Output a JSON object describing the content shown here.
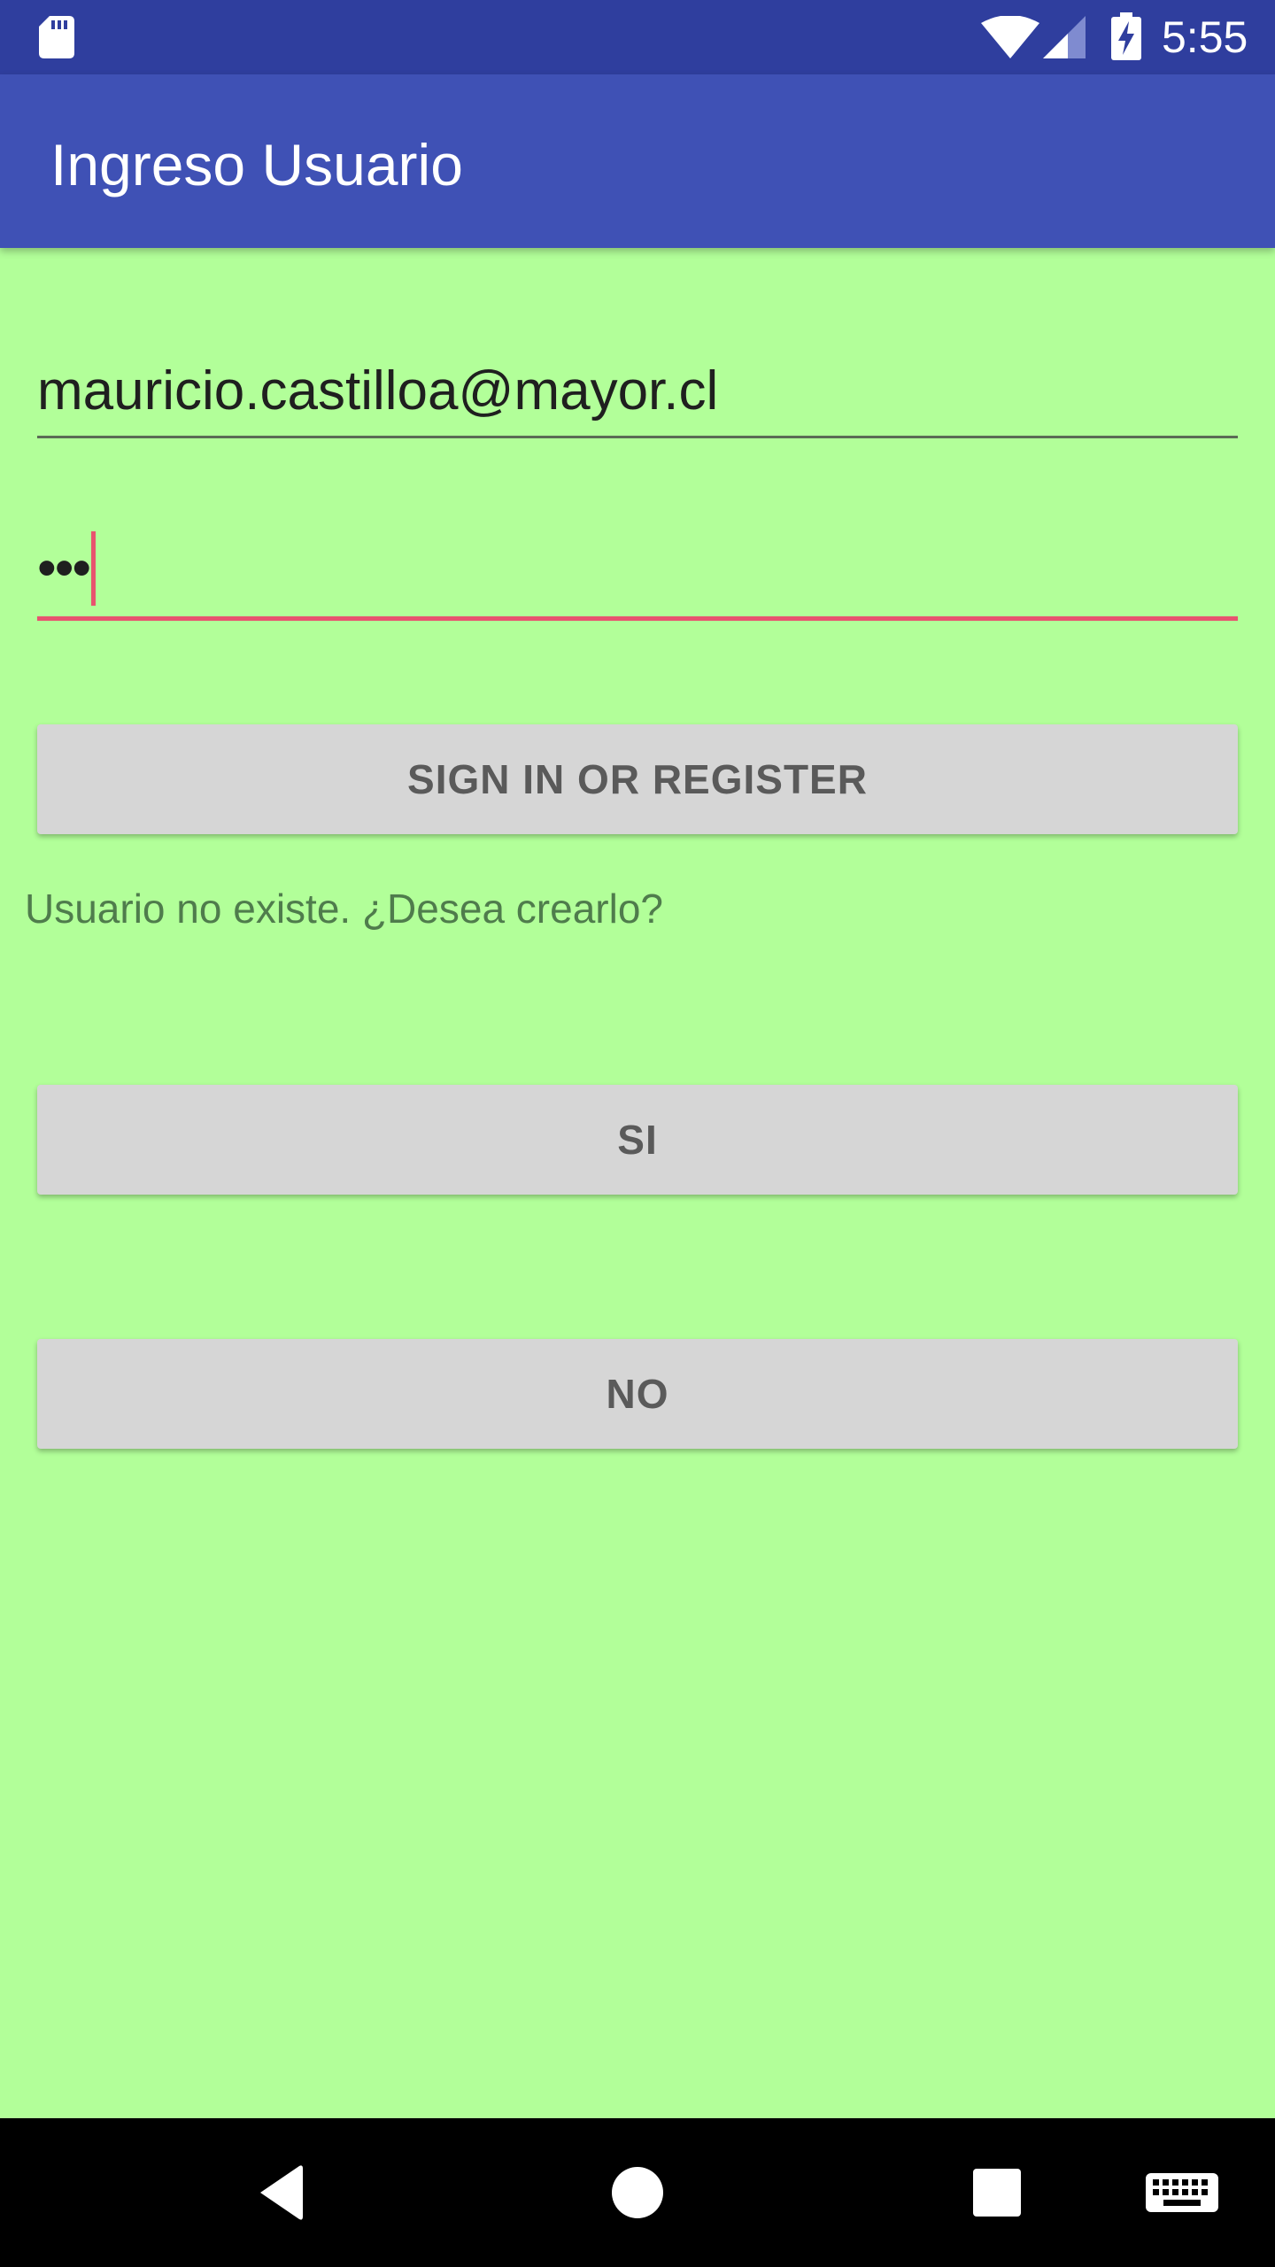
{
  "status_bar": {
    "time": "5:55",
    "icons": [
      "sd-card-icon",
      "wifi-icon",
      "signal-icon",
      "battery-charging-icon"
    ]
  },
  "app_bar": {
    "title": "Ingreso Usuario"
  },
  "form": {
    "email_value": "mauricio.castilloa@mayor.cl",
    "password_masked": "•••",
    "sign_in_label": "SIGN IN OR REGISTER",
    "message": "Usuario no existe. ¿Desea crearlo?",
    "yes_label": "SI",
    "no_label": "NO"
  },
  "nav_bar": {
    "icons": [
      "back-icon",
      "home-icon",
      "recents-icon",
      "keyboard-icon"
    ]
  },
  "colors": {
    "status_bar": "#2f3e9e",
    "app_bar": "#3f51b5",
    "background": "#b2ff99",
    "button": "#d6d6d6",
    "accent": "#e8536f",
    "message_text": "#4f7c4c"
  }
}
